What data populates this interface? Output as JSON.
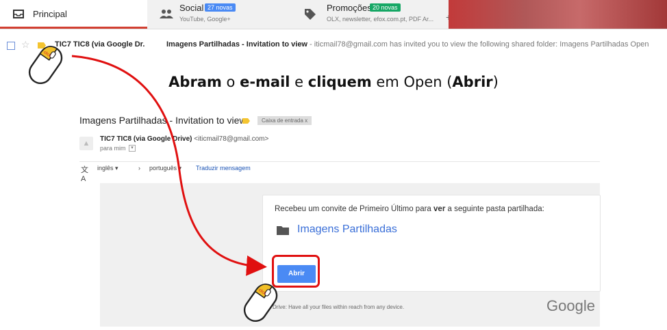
{
  "tabs": [
    {
      "title": "Principal",
      "subtitle": "",
      "badge": ""
    },
    {
      "title": "Social",
      "subtitle": "YouTube, Google+",
      "badge": "27 novas"
    },
    {
      "title": "Promoções",
      "subtitle": "OLX, newsletter, efox.com.pt, PDF Ar...",
      "badge": "20 novas"
    }
  ],
  "add_tab": "+",
  "inbox_row": {
    "sender": "TIC7 TIC8 (via Google Dr.",
    "subject": "Imagens Partilhadas - Invitation to view",
    "snippet": " - iticmail78@gmail.com has invited you to view the following shared folder: Imagens Partilhadas Open"
  },
  "instruction": {
    "p1": "Abram",
    "p2": " o ",
    "p3": "e-mail",
    "p4": " e ",
    "p5": "cliquem",
    "p6": " em Open (",
    "p7": "Abrir",
    "p8": ")"
  },
  "email": {
    "subject": "Imagens Partilhadas - Invitation to view",
    "label": "Caixa de entrada   x",
    "sender_name": "TIC7 TIC8 (via Google Drive)",
    "sender_email": " <iticmail78@gmail.com>",
    "to": "para mim",
    "translate": {
      "from_lang": "inglês ▾",
      "arrow": "›",
      "to_lang": "português ▾",
      "link": "Traduzir mensagem"
    },
    "card": {
      "message_pre": "Recebeu um convite de Primeiro Último para ",
      "message_bold": "ver",
      "message_post": " a seguinte pasta partilhada:",
      "folder_name": "Imagens Partilhadas",
      "button": "Abrir"
    },
    "footer": "Google Drive: Have all your files within reach from any device.",
    "logo": "Google"
  },
  "mouse_label": "click",
  "colors": {
    "accent_red": "#e01010",
    "button_blue": "#4a8af4",
    "badge_blue": "#4a8af4",
    "badge_green": "#16a765"
  }
}
